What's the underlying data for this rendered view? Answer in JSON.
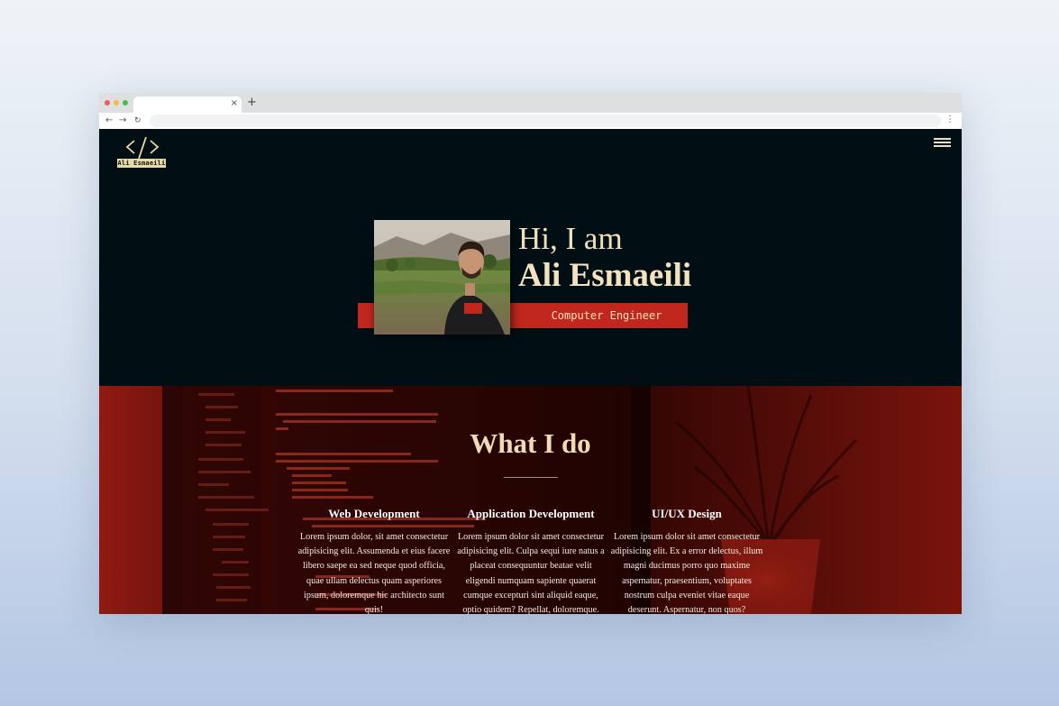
{
  "browser": {
    "new_tab": "+",
    "tab_close": "×",
    "back": "←",
    "forward": "→",
    "reload": "↻",
    "menu": "⋮",
    "url": ""
  },
  "site": {
    "logo_text": "Ali Esmaeili",
    "menu_icon": "hamburger-icon"
  },
  "hero": {
    "greeting": "Hi, I am",
    "name": "Ali Esmaeili",
    "subtitle": "Computer Engineer",
    "accent_color": "#c1271d",
    "background_color": "#010f15"
  },
  "services": {
    "title": "What I do",
    "items": [
      {
        "title": "Web Development",
        "body": "Lorem ipsum dolor, sit amet consectetur adipisicing elit. Assumenda et eius facere libero saepe ea sed neque quod officia, quae ullam delectus quam asperiores ipsum, doloremque hic architecto sunt quis!"
      },
      {
        "title": "Application Development",
        "body": "Lorem ipsum dolor sit amet consectetur adipisicing elit. Culpa sequi iure natus a placeat consequuntur beatae velit eligendi numquam sapiente quaerat cumque excepturi sint aliquid eaque, optio quidem? Repellat, doloremque."
      },
      {
        "title": "UI/UX Design",
        "body": "Lorem ipsum dolor sit amet consectetur adipisicing elit. Ex a error delectus, illum magni ducimus porro quo maxime aspernatur, praesentium, voluptates nostrum culpa eveniet vitae eaque deserunt. Aspernatur, non quos?"
      }
    ]
  }
}
